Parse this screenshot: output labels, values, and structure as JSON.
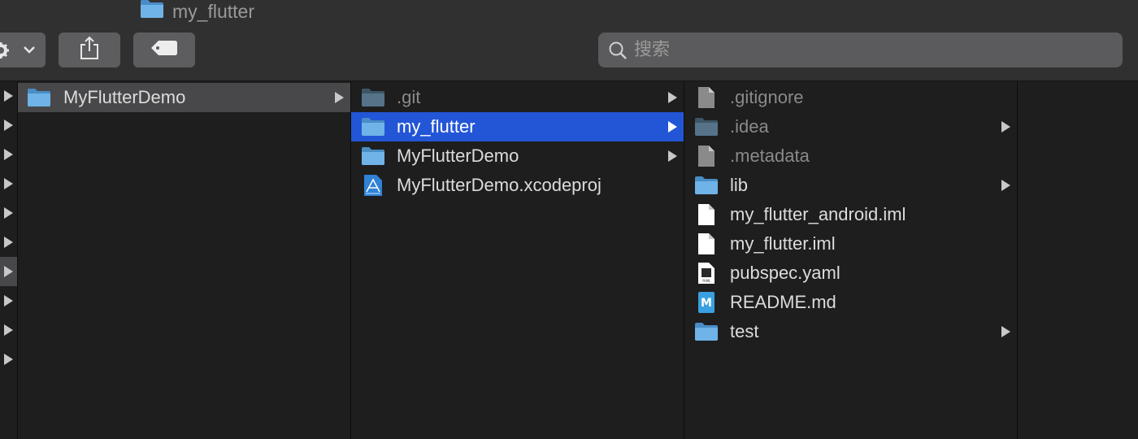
{
  "window": {
    "title": "my_flutter"
  },
  "toolbar": {
    "action_icon": "gear-icon",
    "share_icon": "share-icon",
    "tag_icon": "tag-icon"
  },
  "search": {
    "placeholder": "搜索",
    "value": ""
  },
  "columns": [
    {
      "items": [
        {
          "name": "MyFlutterDemo",
          "kind": "folder",
          "has_children": true,
          "selected": "inactive"
        }
      ]
    },
    {
      "items": [
        {
          "name": ".git",
          "kind": "folder",
          "hidden": true,
          "has_children": true
        },
        {
          "name": "my_flutter",
          "kind": "folder",
          "has_children": true,
          "selected": "active"
        },
        {
          "name": "MyFlutterDemo",
          "kind": "folder",
          "has_children": true
        },
        {
          "name": "MyFlutterDemo.xcodeproj",
          "kind": "xcodeproj",
          "has_children": false
        }
      ]
    },
    {
      "items": [
        {
          "name": ".gitignore",
          "kind": "file",
          "hidden": true
        },
        {
          "name": ".idea",
          "kind": "folder",
          "hidden": true,
          "has_children": true
        },
        {
          "name": ".metadata",
          "kind": "file",
          "hidden": true
        },
        {
          "name": "lib",
          "kind": "folder",
          "has_children": true
        },
        {
          "name": "my_flutter_android.iml",
          "kind": "file"
        },
        {
          "name": "my_flutter.iml",
          "kind": "file"
        },
        {
          "name": "pubspec.yaml",
          "kind": "yaml"
        },
        {
          "name": "README.md",
          "kind": "markdown"
        },
        {
          "name": "test",
          "kind": "folder",
          "has_children": true
        }
      ]
    }
  ],
  "colors": {
    "selection_active": "#2356d6",
    "selection_inactive": "#48484a",
    "folder": "#6fb3e8"
  }
}
